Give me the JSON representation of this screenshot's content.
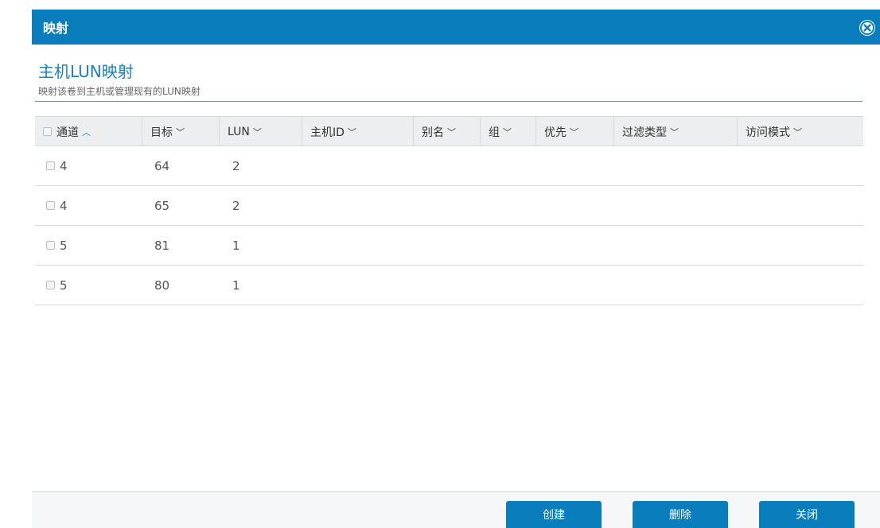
{
  "dialog": {
    "title": "映射",
    "close_icon": "close-circle-icon"
  },
  "header": {
    "heading": "主机LUN映射",
    "subheading": "映射该卷到主机或管理现有的LUN映射"
  },
  "table": {
    "columns": [
      {
        "label": "通道",
        "sort": "asc"
      },
      {
        "label": "目标",
        "sort": "desc"
      },
      {
        "label": "LUN",
        "sort": "desc"
      },
      {
        "label": "主机ID",
        "sort": "desc"
      },
      {
        "label": "别名",
        "sort": "desc"
      },
      {
        "label": "组",
        "sort": "desc"
      },
      {
        "label": "优先",
        "sort": "desc"
      },
      {
        "label": "过滤类型",
        "sort": "desc"
      },
      {
        "label": "访问模式",
        "sort": "desc"
      }
    ],
    "rows": [
      {
        "channel": "4",
        "target": "64",
        "lun": "2"
      },
      {
        "channel": "4",
        "target": "65",
        "lun": "2"
      },
      {
        "channel": "5",
        "target": "81",
        "lun": "1"
      },
      {
        "channel": "5",
        "target": "80",
        "lun": "1"
      }
    ]
  },
  "footer": {
    "create_label": "创建",
    "delete_label": "删除",
    "close_label": "关闭"
  },
  "colors": {
    "accent": "#0a7ebc",
    "heading": "#1b7fc0"
  }
}
